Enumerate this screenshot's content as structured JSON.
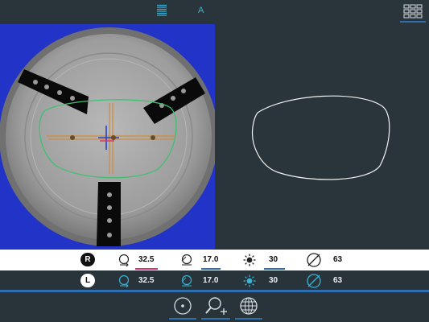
{
  "topbar": {
    "list_view_icon": "list-lines-icon",
    "mode_letter": "A",
    "grid_view_icon": "grid-icon"
  },
  "right_lens": {
    "side": "R",
    "measurements": [
      {
        "icon": "lens-offset-icon",
        "value": "32.5",
        "underline_color": "#e0336e"
      },
      {
        "icon": "lens-height-icon",
        "value": "17.0",
        "underline_color": "#2d6fb0"
      },
      {
        "icon": "brightness-icon",
        "value": "30",
        "underline_color": "#2d6fb0"
      },
      {
        "icon": "diameter-icon",
        "value": "63"
      }
    ]
  },
  "left_lens": {
    "side": "L",
    "measurements": [
      {
        "icon": "lens-offset-icon",
        "value": "32.5"
      },
      {
        "icon": "lens-height-icon",
        "value": "17.0"
      },
      {
        "icon": "brightness-icon",
        "value": "30"
      },
      {
        "icon": "diameter-icon",
        "value": "63"
      }
    ]
  },
  "bottombar": {
    "buttons": [
      "center-target-icon",
      "zoom-add-icon",
      "globe-grid-icon"
    ]
  },
  "colors": {
    "background": "#2a343b",
    "accent": "#2d6fb0",
    "icon_cyan": "#3ab3d6",
    "camera_bg": "#2233c8",
    "frame_outline": "#3fc070",
    "alert": "#e0336e"
  }
}
